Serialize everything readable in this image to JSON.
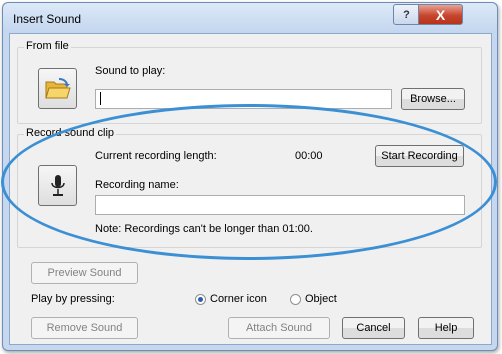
{
  "window": {
    "title": "Insert Sound",
    "help_glyph": "?",
    "close_glyph": "X"
  },
  "from_file": {
    "legend": "From file",
    "folder_icon": "folder-open-icon",
    "sound_label": "Sound to play:",
    "sound_value": "",
    "browse_label": "Browse..."
  },
  "record": {
    "legend": "Record sound clip",
    "mic_icon": "microphone-icon",
    "length_label": "Current recording length:",
    "length_value": "00:00",
    "start_label": "Start Recording",
    "name_label": "Recording name:",
    "name_value": "",
    "note": "Note: Recordings can't be longer than 01:00."
  },
  "preview_label": "Preview Sound",
  "play_label": "Play by pressing:",
  "radios": [
    {
      "label": "Corner icon",
      "selected": true
    },
    {
      "label": "Object",
      "selected": false
    }
  ],
  "buttons": {
    "remove": "Remove Sound",
    "attach": "Attach Sound",
    "cancel": "Cancel",
    "help": "Help"
  },
  "colors": {
    "annotation_ellipse": "#3b8fd4",
    "title_bar": "#c5d8ef"
  }
}
